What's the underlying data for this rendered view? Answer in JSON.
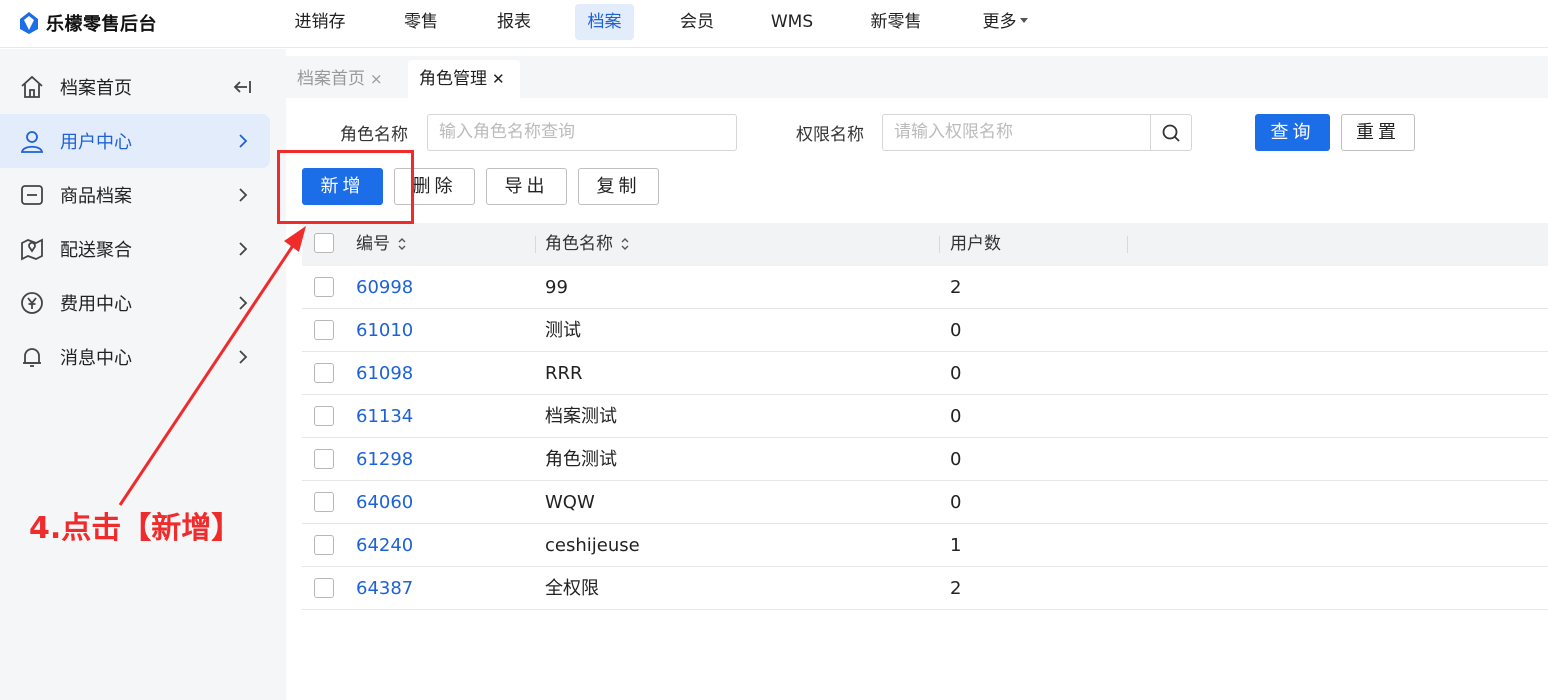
{
  "app": {
    "logo_text": "乐檬零售后台",
    "brand_color": "#1c6de8"
  },
  "nav": {
    "items": [
      "进销存",
      "零售",
      "报表",
      "档案",
      "会员",
      "WMS",
      "新零售",
      "更多"
    ],
    "active": "档案"
  },
  "sidebar": {
    "items": [
      {
        "label": "档案首页",
        "icon": "home-icon"
      },
      {
        "label": "用户中心",
        "icon": "user-icon"
      },
      {
        "label": "商品档案",
        "icon": "product-icon"
      },
      {
        "label": "配送聚合",
        "icon": "delivery-icon"
      },
      {
        "label": "费用中心",
        "icon": "yuan-icon"
      },
      {
        "label": "消息中心",
        "icon": "bell-icon"
      }
    ],
    "active": "用户中心"
  },
  "tabs": [
    {
      "label": "档案首页",
      "close": "×"
    },
    {
      "label": "角色管理",
      "close": "✕"
    }
  ],
  "filters": {
    "role_name_label": "角色名称",
    "role_name_placeholder": "输入角色名称查询",
    "perm_name_label": "权限名称",
    "perm_name_placeholder": "请输入权限名称",
    "query_button": "查询",
    "reset_button": "重置"
  },
  "actions": {
    "add": "新增",
    "delete": "删除",
    "export": "导出",
    "copy": "复制"
  },
  "table": {
    "columns": [
      "编号",
      "角色名称",
      "用户数"
    ],
    "rows": [
      {
        "id": "60998",
        "name": "99",
        "users": "2"
      },
      {
        "id": "61010",
        "name": "测试",
        "users": "0"
      },
      {
        "id": "61098",
        "name": "RRR",
        "users": "0"
      },
      {
        "id": "61134",
        "name": "档案测试",
        "users": "0"
      },
      {
        "id": "61298",
        "name": "角色测试",
        "users": "0"
      },
      {
        "id": "64060",
        "name": "WQW",
        "users": "0"
      },
      {
        "id": "64240",
        "name": "ceshijeuse",
        "users": "1"
      },
      {
        "id": "64387",
        "name": "全权限",
        "users": "2"
      }
    ]
  },
  "annotation": {
    "text": "4.点击【新增】",
    "color": "#ef2b2b"
  }
}
